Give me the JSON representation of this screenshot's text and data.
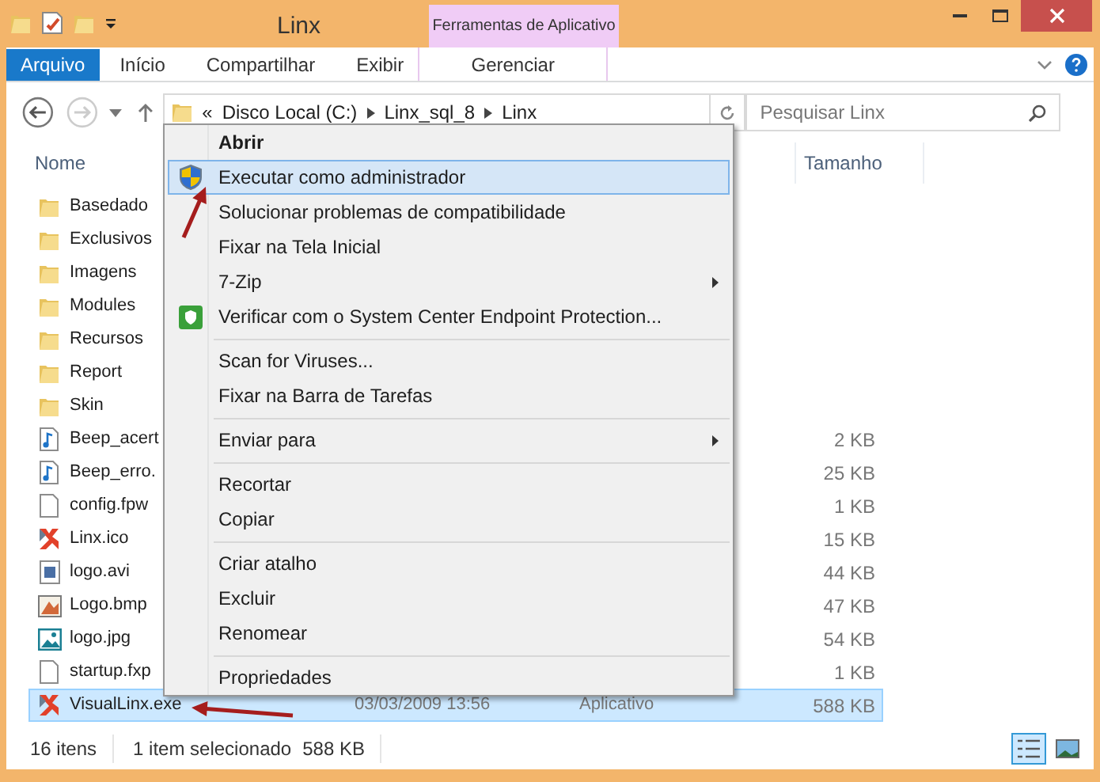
{
  "window": {
    "title": "Linx",
    "context_tab": "Ferramentas de Aplicativo"
  },
  "ribbon_tabs": [
    {
      "label": "Arquivo",
      "kind": "file"
    },
    {
      "label": "Início",
      "kind": "tab"
    },
    {
      "label": "Compartilhar",
      "kind": "tab"
    },
    {
      "label": "Exibir",
      "kind": "tab"
    },
    {
      "label": "Gerenciar",
      "kind": "context"
    }
  ],
  "address": {
    "overflow": "«",
    "crumbs": [
      "Disco Local (C:)",
      "Linx_sql_8",
      "Linx"
    ]
  },
  "search": {
    "placeholder": "Pesquisar Linx"
  },
  "columns": [
    "Nome",
    "Tamanho"
  ],
  "files": [
    {
      "name": "Basedado",
      "kind": "folder",
      "selected": false
    },
    {
      "name": "Exclusivos",
      "kind": "folder",
      "selected": false
    },
    {
      "name": "Imagens",
      "kind": "folder",
      "selected": false
    },
    {
      "name": "Modules",
      "kind": "folder",
      "selected": false
    },
    {
      "name": "Recursos",
      "kind": "folder",
      "selected": false
    },
    {
      "name": "Report",
      "kind": "folder",
      "selected": false
    },
    {
      "name": "Skin",
      "kind": "folder",
      "selected": false
    },
    {
      "name": "Beep_acert",
      "kind": "audio",
      "size": "2 KB",
      "selected": false
    },
    {
      "name": "Beep_erro.",
      "kind": "audio",
      "size": "25 KB",
      "selected": false
    },
    {
      "name": "config.fpw",
      "kind": "document",
      "size": "1 KB",
      "selected": false
    },
    {
      "name": "Linx.ico",
      "kind": "app",
      "size": "15 KB",
      "selected": false
    },
    {
      "name": "logo.avi",
      "kind": "video",
      "size": "44 KB",
      "selected": false
    },
    {
      "name": "Logo.bmp",
      "kind": "bitmap",
      "size": "47 KB",
      "selected": false
    },
    {
      "name": "logo.jpg",
      "kind": "image",
      "size": "54 KB",
      "selected": false
    },
    {
      "name": "startup.fxp",
      "kind": "document",
      "size": "1 KB",
      "selected": false
    },
    {
      "name": "VisualLinx.exe",
      "kind": "app",
      "date": "03/03/2009 13:56",
      "type": "Aplicativo",
      "size": "588 KB",
      "selected": true
    }
  ],
  "context_menu": [
    {
      "kind": "item",
      "label": "Abrir",
      "bold": true,
      "selected": false
    },
    {
      "kind": "admin",
      "label": "Executar como administrador",
      "selected": true
    },
    {
      "kind": "item",
      "label": "Solucionar problemas de compatibilidade",
      "selected": false
    },
    {
      "kind": "item",
      "label": "Fixar na Tela Inicial",
      "selected": false
    },
    {
      "kind": "item",
      "label": "7-Zip",
      "submenu": true,
      "selected": false
    },
    {
      "kind": "scan",
      "label": "Verificar com o System Center Endpoint Protection...",
      "selected": false
    },
    {
      "kind": "separator"
    },
    {
      "kind": "item",
      "label": "Scan for Viruses...",
      "selected": false
    },
    {
      "kind": "item",
      "label": "Fixar na Barra de Tarefas",
      "selected": false
    },
    {
      "kind": "separator"
    },
    {
      "kind": "item",
      "label": "Enviar para",
      "submenu": true,
      "selected": false
    },
    {
      "kind": "separator"
    },
    {
      "kind": "item",
      "label": "Recortar",
      "selected": false
    },
    {
      "kind": "item",
      "label": "Copiar",
      "selected": false
    },
    {
      "kind": "separator"
    },
    {
      "kind": "item",
      "label": "Criar atalho",
      "selected": false
    },
    {
      "kind": "item",
      "label": "Excluir",
      "selected": false
    },
    {
      "kind": "item",
      "label": "Renomear",
      "selected": false
    },
    {
      "kind": "separator"
    },
    {
      "kind": "item",
      "label": "Propriedades",
      "selected": false
    }
  ],
  "status_bar": {
    "count": "16 itens",
    "selection": "1 item selecionado",
    "size": "588 KB"
  }
}
